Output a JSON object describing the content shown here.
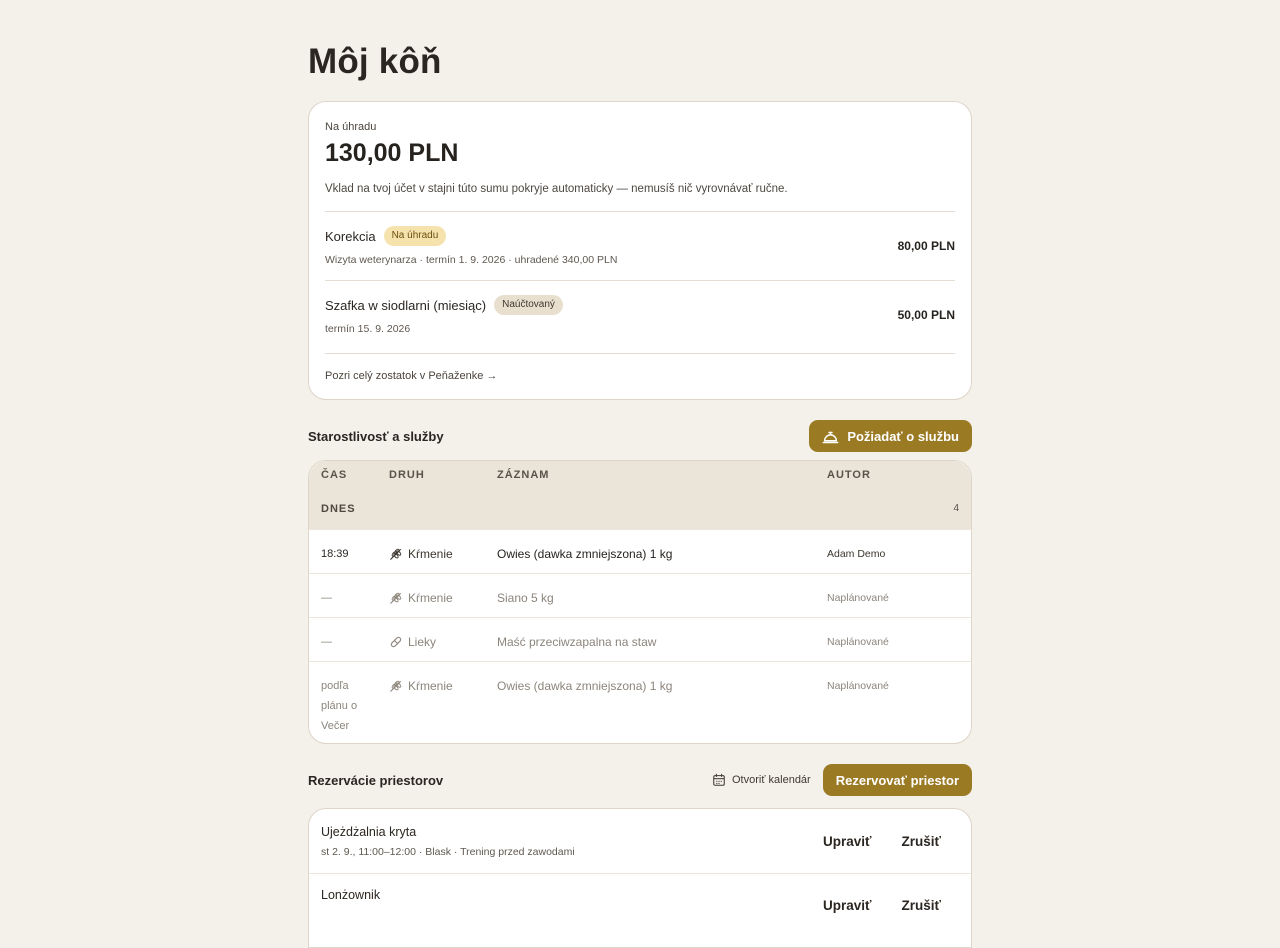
{
  "page": {
    "title": "Môj kôň"
  },
  "payment": {
    "label": "Na úhradu",
    "amount": "130,00 PLN",
    "note": "Vklad na tvoj účet v stajni túto sumu pokryje automaticky — nemusíš nič vyrovnávať ručne.",
    "charges": [
      {
        "name": "Korekcia",
        "badge": "Na úhradu",
        "badge_kind": "due",
        "sub": "Wizyta weterynarza · termín 1. 9. 2026 · uhradené 340,00 PLN",
        "amount": "80,00 PLN"
      },
      {
        "name": "Szafka w siodlarni (miesiąc)",
        "badge": "Naúčtovaný",
        "badge_kind": "billed",
        "sub": "termín 15. 9. 2026",
        "amount": "50,00 PLN"
      }
    ],
    "wallet_link": "Pozri celý zostatok v Peňaženke →"
  },
  "care": {
    "title": "Starostlivosť a služby",
    "request_button": "Požiadať o službu",
    "request_icon": "service-bell-icon",
    "columns": {
      "time": "ČAS",
      "kind": "DRUH",
      "entry": "ZÁZNAM",
      "author": "AUTOR"
    },
    "group": {
      "label": "DNES",
      "count": "4"
    },
    "rows": [
      {
        "time": "18:39",
        "kind": "Kŕmenie",
        "kind_icon": "wheat-icon",
        "entry": "Owies (dawka zmniejszona) 1 kg",
        "author": "Adam Demo",
        "state": "done"
      },
      {
        "time": "—",
        "kind": "Kŕmenie",
        "kind_icon": "wheat-icon",
        "entry": "Siano 5 kg",
        "author": "Naplánované",
        "state": "planned"
      },
      {
        "time": "—",
        "kind": "Lieky",
        "kind_icon": "pill-icon",
        "entry": "Maść przeciwzapalna na staw",
        "author": "Naplánované",
        "state": "planned"
      },
      {
        "time": "podľa plánu o Večer",
        "kind": "Kŕmenie",
        "kind_icon": "wheat-icon",
        "entry": "Owies (dawka zmniejszona) 1 kg",
        "author": "Naplánované",
        "state": "planned"
      }
    ]
  },
  "reservations": {
    "title": "Rezervácie priestorov",
    "calendar_link": "Otvoriť kalendár",
    "calendar_icon": "calendar-icon",
    "reserve_button": "Rezervovať priestor",
    "items": [
      {
        "name": "Ujeżdżalnia kryta",
        "sub": "st 2. 9., 11:00–12:00 · Blask · Trening przed zawodami",
        "edit": "Upraviť",
        "cancel": "Zrušiť"
      },
      {
        "name": "Lonżownik",
        "sub": "",
        "edit": "Upraviť",
        "cancel": "Zrušiť"
      }
    ]
  },
  "colors": {
    "background": "#f4f1eb",
    "accent": "#9b7a24",
    "badge_due": "#f6e2ad",
    "badge_billed": "#e8dfcf",
    "table_header": "#ebe4d9"
  }
}
